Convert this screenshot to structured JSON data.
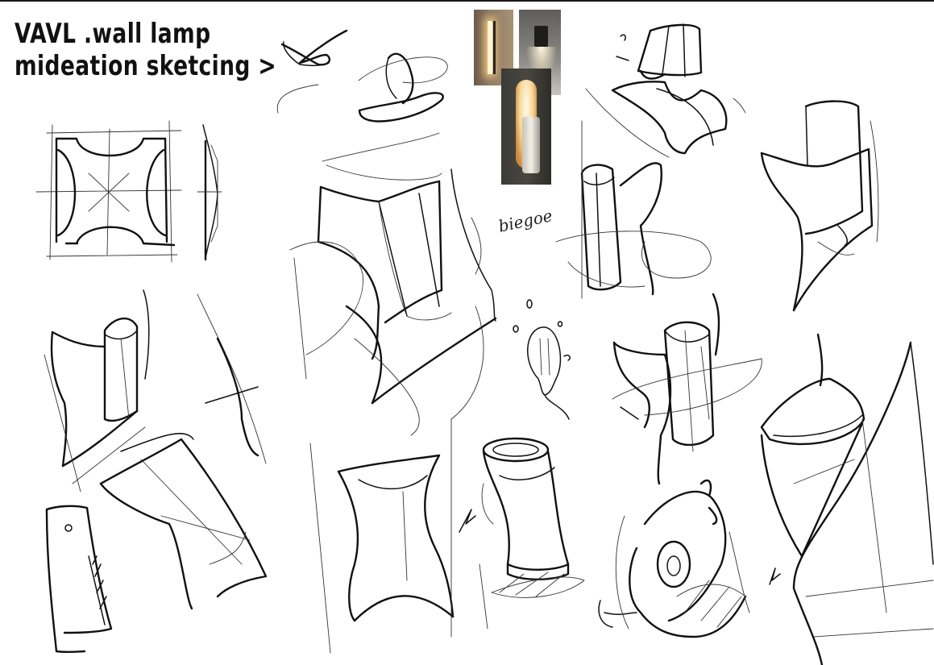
{
  "title": {
    "line1": "VAVL .wall lamp",
    "line2": "mideation sketcing >"
  },
  "annotation": "biegoe",
  "reference_photos": [
    {
      "name": "linear-wall-lamp-photo"
    },
    {
      "name": "cylinder-up-down-lamp-photo"
    },
    {
      "name": "glowing-tube-lamp-photo"
    }
  ],
  "colors": {
    "ink": "#111111",
    "background": "#ffffff",
    "warm_glow": "#f3c77a",
    "grey_wall": "#9a9a98",
    "dark_wall": "#3b3a36"
  }
}
